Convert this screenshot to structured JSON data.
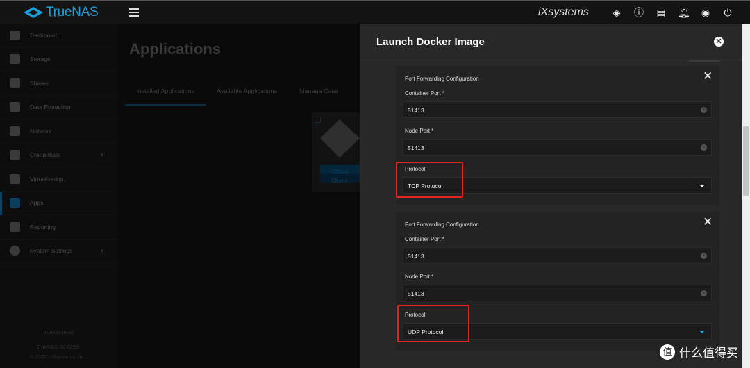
{
  "header": {
    "brand": "TrueNAS",
    "brand_sub": "SCALE",
    "vendor": "iXsystems",
    "icons": [
      "truecommand-icon",
      "info-icon",
      "clipboard-icon",
      "bell-icon",
      "account-icon",
      "power-icon"
    ]
  },
  "sidebar": {
    "items": [
      {
        "label": "Dashboard",
        "icon": "dashboard-icon"
      },
      {
        "label": "Storage",
        "icon": "storage-icon"
      },
      {
        "label": "Shares",
        "icon": "shares-icon"
      },
      {
        "label": "Data Protection",
        "icon": "shield-icon"
      },
      {
        "label": "Network",
        "icon": "network-icon"
      },
      {
        "label": "Credentials",
        "icon": "key-icon",
        "chevron": true
      },
      {
        "label": "Virtualization",
        "icon": "laptop-icon"
      },
      {
        "label": "Apps",
        "icon": "apps-icon",
        "active": true
      },
      {
        "label": "Reporting",
        "icon": "reporting-icon"
      },
      {
        "label": "System Settings",
        "icon": "gear-icon",
        "chevron": true
      }
    ],
    "hostname": "truenas.local",
    "product": "TrueNAS SCALE®",
    "copyright": "© 2022 - iXsystems, Inc."
  },
  "main": {
    "title": "Applications",
    "tabs": [
      "Installed Applications",
      "Available Applications",
      "Manage Catalogs"
    ],
    "app_card": {
      "badges": [
        "Official",
        "Charts"
      ]
    }
  },
  "panel": {
    "title": "Launch Docker Image",
    "cards": [
      {
        "title": "Port Forwarding Configuration",
        "container_port_label": "Container Port *",
        "container_port": "51413",
        "node_port_label": "Node Port *",
        "node_port": "51413",
        "protocol_label": "Protocol",
        "protocol": "TCP Protocol"
      },
      {
        "title": "Port Forwarding Configuration",
        "container_port_label": "Container Port *",
        "container_port": "51413",
        "node_port_label": "Node Port *",
        "node_port": "51413",
        "protocol_label": "Protocol",
        "protocol": "UDP Protocol"
      }
    ]
  },
  "watermark": {
    "glyph": "值",
    "text": "什么值得买"
  },
  "colors": {
    "accent": "#1a9fd8",
    "highlight": "#e0261e",
    "panel": "#282828"
  }
}
